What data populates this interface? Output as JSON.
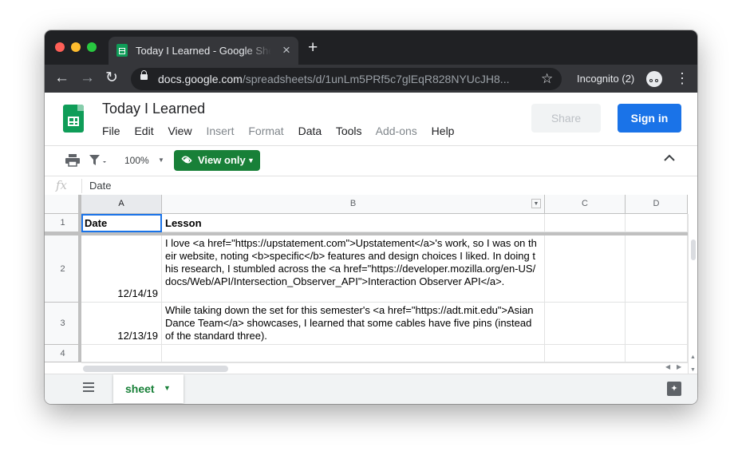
{
  "browser": {
    "tab_title": "Today I Learned - Google Sheets",
    "tab_close": "×",
    "new_tab": "+",
    "url_host": "docs.google.com",
    "url_path": "/spreadsheets/d/1unLm5PRf5c7glEqR828NYUcJH8...",
    "incognito_label": "Incognito (2)",
    "back_icon": "←",
    "forward_icon": "→",
    "reload_icon": "↻",
    "star_icon": "☆",
    "menu_icon": "⋮"
  },
  "doc": {
    "title": "Today I Learned",
    "menu": [
      "File",
      "Edit",
      "View",
      "Insert",
      "Format",
      "Data",
      "Tools",
      "Add-ons",
      "Help"
    ],
    "share_label": "Share",
    "signin_label": "Sign in"
  },
  "toolbar": {
    "zoom": "100%",
    "view_only_label": "View only",
    "caret": "▼",
    "collapse": "︿"
  },
  "formula_bar": {
    "fx": "fx",
    "value": "Date"
  },
  "grid": {
    "columns": [
      "A",
      "B",
      "C",
      "D"
    ],
    "rows": [
      {
        "num": "1",
        "date": "Date",
        "lesson": "Lesson"
      },
      {
        "num": "2",
        "date": "12/14/19",
        "lesson": "I love <a href=\"https://upstatement.com\">Upstatement</a>'s work, so I was on their website, noting <b>specific</b> features and design choices I liked. In doing this research, I stumbled across the <a href=\"https://developer.mozilla.org/en-US/docs/Web/API/Intersection_Observer_API\">Interaction Observer API</a>."
      },
      {
        "num": "3",
        "date": "12/13/19",
        "lesson": "While taking down the set for this semester's <a href=\"https://adt.mit.edu\">Asian Dance Team</a> showcases, I learned that some cables have five pins (instead of the standard three)."
      },
      {
        "num": "4",
        "date": "",
        "lesson": ""
      }
    ]
  },
  "sheets": {
    "active": "sheet",
    "caret": "▼"
  },
  "colors": {
    "accent_green": "#188038",
    "signin_blue": "#1a73e8",
    "chrome_dark": "#202124"
  }
}
